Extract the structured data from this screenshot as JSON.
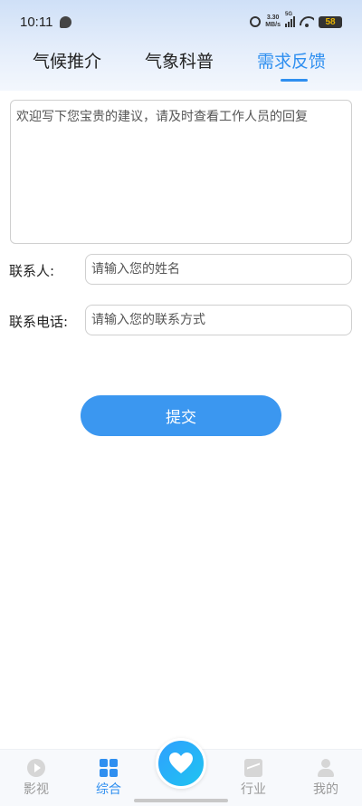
{
  "status_bar": {
    "time": "10:11",
    "net_speed_value": "3.30",
    "net_speed_unit": "MB/s",
    "signal_label": "5G",
    "battery": "58"
  },
  "tabs": [
    {
      "label": "气候推介",
      "active": false
    },
    {
      "label": "气象科普",
      "active": false
    },
    {
      "label": "需求反馈",
      "active": true
    }
  ],
  "form": {
    "feedback_placeholder": "欢迎写下您宝贵的建议，请及时查看工作人员的回复",
    "contact_label": "联系人:",
    "contact_placeholder": "请输入您的姓名",
    "phone_label": "联系电话:",
    "phone_placeholder": "请输入您的联系方式",
    "submit_label": "提交"
  },
  "bottom_nav": [
    {
      "label": "影视",
      "icon": "play-circle-icon",
      "active": false
    },
    {
      "label": "综合",
      "icon": "grid-icon",
      "active": true
    },
    {
      "label": "",
      "icon": "heart-icon",
      "active": false
    },
    {
      "label": "行业",
      "icon": "chart-icon",
      "active": false
    },
    {
      "label": "我的",
      "icon": "person-icon",
      "active": false
    }
  ],
  "colors": {
    "accent": "#2f8ff0",
    "submit_button": "#3b97f0",
    "header_gradient_top": "#cfe0f7",
    "inactive_nav": "#999999"
  }
}
